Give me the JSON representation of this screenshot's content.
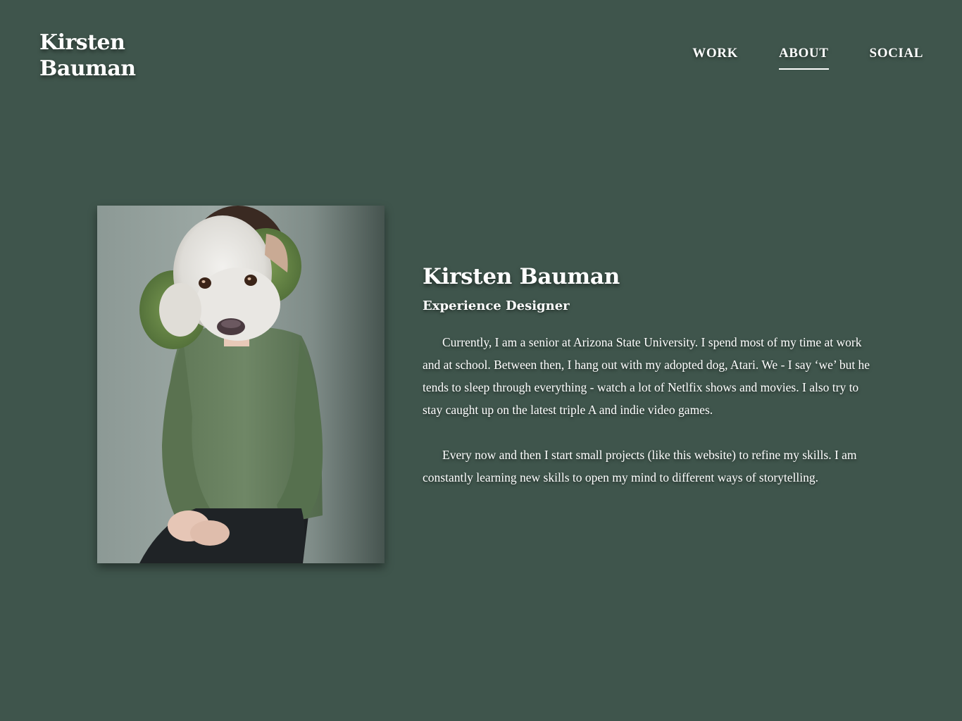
{
  "header": {
    "logo_line1": "Kirsten",
    "logo_line2": "Bauman",
    "nav": [
      {
        "label": "WORK",
        "active": false
      },
      {
        "label": "ABOUT",
        "active": true
      },
      {
        "label": "SOCIAL",
        "active": false
      }
    ]
  },
  "about": {
    "name": "Kirsten Bauman",
    "role": "Experience Designer",
    "paragraphs": [
      "Currently, I am a senior at Arizona State University. I spend most of my time at work and at school. Between then, I hang out with my adopted dog, Atari. We - I say ‘we’ but he tends to sleep through everything - watch a lot of Netlfix shows and movies. I also try to stay caught up on the latest triple A and indie video games.",
      "Every now and then I start small projects (like this website) to refine my skills. I am constantly learning new skills to open my mind to different ways of storytelling."
    ]
  },
  "colors": {
    "background": "#3f554c",
    "text": "#ffffff"
  }
}
